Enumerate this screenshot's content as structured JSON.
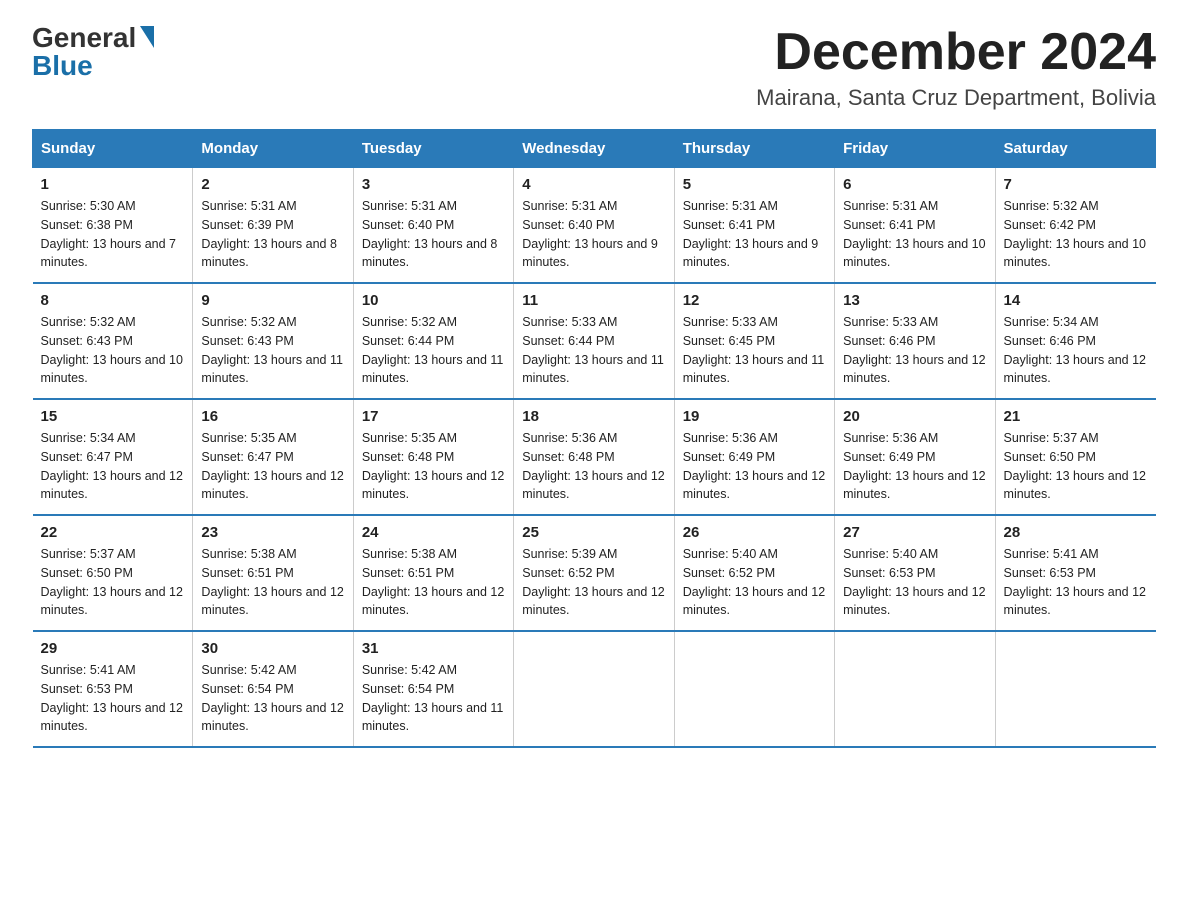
{
  "header": {
    "logo_general": "General",
    "logo_blue": "Blue",
    "month": "December 2024",
    "location": "Mairana, Santa Cruz Department, Bolivia"
  },
  "days_of_week": [
    "Sunday",
    "Monday",
    "Tuesday",
    "Wednesday",
    "Thursday",
    "Friday",
    "Saturday"
  ],
  "weeks": [
    [
      {
        "day": "1",
        "sunrise": "5:30 AM",
        "sunset": "6:38 PM",
        "daylight": "13 hours and 7 minutes."
      },
      {
        "day": "2",
        "sunrise": "5:31 AM",
        "sunset": "6:39 PM",
        "daylight": "13 hours and 8 minutes."
      },
      {
        "day": "3",
        "sunrise": "5:31 AM",
        "sunset": "6:40 PM",
        "daylight": "13 hours and 8 minutes."
      },
      {
        "day": "4",
        "sunrise": "5:31 AM",
        "sunset": "6:40 PM",
        "daylight": "13 hours and 9 minutes."
      },
      {
        "day": "5",
        "sunrise": "5:31 AM",
        "sunset": "6:41 PM",
        "daylight": "13 hours and 9 minutes."
      },
      {
        "day": "6",
        "sunrise": "5:31 AM",
        "sunset": "6:41 PM",
        "daylight": "13 hours and 10 minutes."
      },
      {
        "day": "7",
        "sunrise": "5:32 AM",
        "sunset": "6:42 PM",
        "daylight": "13 hours and 10 minutes."
      }
    ],
    [
      {
        "day": "8",
        "sunrise": "5:32 AM",
        "sunset": "6:43 PM",
        "daylight": "13 hours and 10 minutes."
      },
      {
        "day": "9",
        "sunrise": "5:32 AM",
        "sunset": "6:43 PM",
        "daylight": "13 hours and 11 minutes."
      },
      {
        "day": "10",
        "sunrise": "5:32 AM",
        "sunset": "6:44 PM",
        "daylight": "13 hours and 11 minutes."
      },
      {
        "day": "11",
        "sunrise": "5:33 AM",
        "sunset": "6:44 PM",
        "daylight": "13 hours and 11 minutes."
      },
      {
        "day": "12",
        "sunrise": "5:33 AM",
        "sunset": "6:45 PM",
        "daylight": "13 hours and 11 minutes."
      },
      {
        "day": "13",
        "sunrise": "5:33 AM",
        "sunset": "6:46 PM",
        "daylight": "13 hours and 12 minutes."
      },
      {
        "day": "14",
        "sunrise": "5:34 AM",
        "sunset": "6:46 PM",
        "daylight": "13 hours and 12 minutes."
      }
    ],
    [
      {
        "day": "15",
        "sunrise": "5:34 AM",
        "sunset": "6:47 PM",
        "daylight": "13 hours and 12 minutes."
      },
      {
        "day": "16",
        "sunrise": "5:35 AM",
        "sunset": "6:47 PM",
        "daylight": "13 hours and 12 minutes."
      },
      {
        "day": "17",
        "sunrise": "5:35 AM",
        "sunset": "6:48 PM",
        "daylight": "13 hours and 12 minutes."
      },
      {
        "day": "18",
        "sunrise": "5:36 AM",
        "sunset": "6:48 PM",
        "daylight": "13 hours and 12 minutes."
      },
      {
        "day": "19",
        "sunrise": "5:36 AM",
        "sunset": "6:49 PM",
        "daylight": "13 hours and 12 minutes."
      },
      {
        "day": "20",
        "sunrise": "5:36 AM",
        "sunset": "6:49 PM",
        "daylight": "13 hours and 12 minutes."
      },
      {
        "day": "21",
        "sunrise": "5:37 AM",
        "sunset": "6:50 PM",
        "daylight": "13 hours and 12 minutes."
      }
    ],
    [
      {
        "day": "22",
        "sunrise": "5:37 AM",
        "sunset": "6:50 PM",
        "daylight": "13 hours and 12 minutes."
      },
      {
        "day": "23",
        "sunrise": "5:38 AM",
        "sunset": "6:51 PM",
        "daylight": "13 hours and 12 minutes."
      },
      {
        "day": "24",
        "sunrise": "5:38 AM",
        "sunset": "6:51 PM",
        "daylight": "13 hours and 12 minutes."
      },
      {
        "day": "25",
        "sunrise": "5:39 AM",
        "sunset": "6:52 PM",
        "daylight": "13 hours and 12 minutes."
      },
      {
        "day": "26",
        "sunrise": "5:40 AM",
        "sunset": "6:52 PM",
        "daylight": "13 hours and 12 minutes."
      },
      {
        "day": "27",
        "sunrise": "5:40 AM",
        "sunset": "6:53 PM",
        "daylight": "13 hours and 12 minutes."
      },
      {
        "day": "28",
        "sunrise": "5:41 AM",
        "sunset": "6:53 PM",
        "daylight": "13 hours and 12 minutes."
      }
    ],
    [
      {
        "day": "29",
        "sunrise": "5:41 AM",
        "sunset": "6:53 PM",
        "daylight": "13 hours and 12 minutes."
      },
      {
        "day": "30",
        "sunrise": "5:42 AM",
        "sunset": "6:54 PM",
        "daylight": "13 hours and 12 minutes."
      },
      {
        "day": "31",
        "sunrise": "5:42 AM",
        "sunset": "6:54 PM",
        "daylight": "13 hours and 11 minutes."
      },
      null,
      null,
      null,
      null
    ]
  ]
}
